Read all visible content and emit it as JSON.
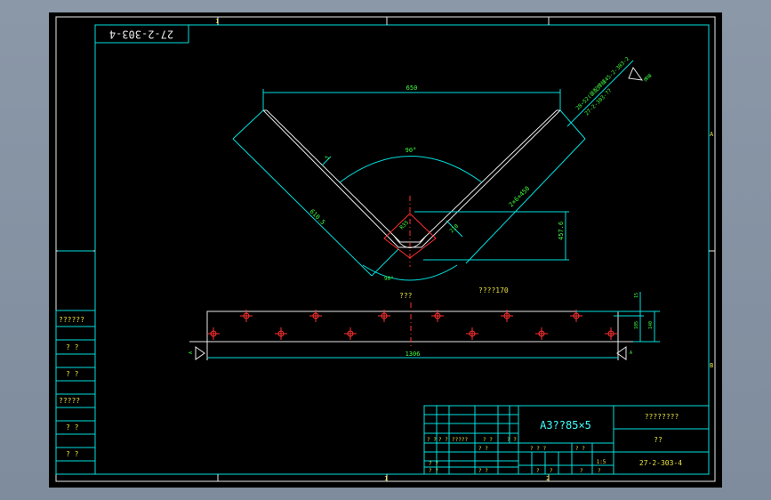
{
  "drawing_number": "27-2-303-4",
  "labels": {
    "dim_top": "650",
    "dim_angle_top": "90°",
    "dim_angle_bottom": "90°",
    "dim_left": "610.5",
    "dim_right": "2×6×450",
    "dim_thickness": "5",
    "dim_center": "210",
    "dim_height": "457.6",
    "dim_radius": "R35",
    "view_note_left": "???",
    "view_note_right": "????170",
    "dim_bottom": "1306",
    "dim_side_1": "15",
    "dim_side_2": "105",
    "dim_side_3": "140",
    "section_left": "A",
    "section_right": "A",
    "callout_1": "28~52(装配焊缝45-2-303-2",
    "callout_2": "27-2-303-??",
    "callout_3": "焊接",
    "border_top": "1",
    "border_right_top": "A",
    "border_right_bottom": "B",
    "border_bottom_left": "1",
    "border_bottom_right": "2"
  },
  "left_blocks": [
    "??????",
    "? ?",
    "? ?",
    "?????",
    "? ?",
    "? ?"
  ],
  "title_block": {
    "material": "A3??85×5",
    "name": "????????",
    "scale_label": "??",
    "number": "27-2-303-4",
    "scale_value": "1:5",
    "left_row_1": [
      "? ?",
      "? ?",
      "?????",
      "? ?",
      "? ?"
    ],
    "left_row_2": "? ?",
    "left_row_3": [
      "? ?",
      "? ?"
    ],
    "mid_row": [
      "? ? ?",
      "? ?"
    ],
    "mid_row_2": [
      "?",
      "?",
      "?",
      "?"
    ]
  }
}
